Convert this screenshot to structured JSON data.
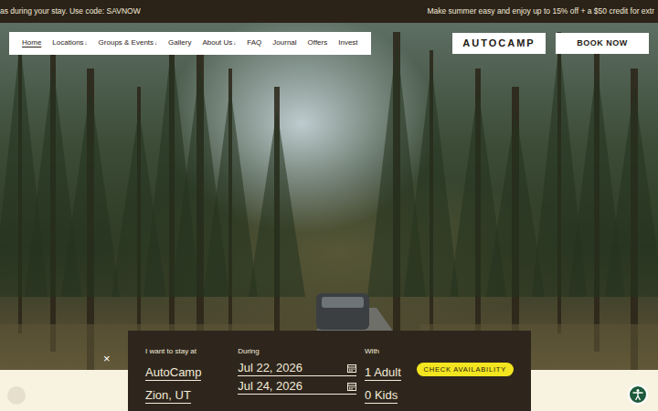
{
  "announcement": {
    "left": "as during your stay. Use code: SAVNOW",
    "right": "Make summer easy and enjoy up to 15% off + a $50 credit for extr"
  },
  "nav": {
    "items": [
      {
        "label": "Home",
        "selected": true
      },
      {
        "label": "Locations",
        "selected": false,
        "caret": "↓"
      },
      {
        "label": "Groups & Events",
        "selected": false,
        "caret": "↓"
      },
      {
        "label": "Gallery",
        "selected": false
      },
      {
        "label": "About Us",
        "selected": false,
        "caret": "↓"
      },
      {
        "label": "FAQ",
        "selected": false
      },
      {
        "label": "Journal",
        "selected": false
      },
      {
        "label": "Offers",
        "selected": false
      },
      {
        "label": "Invest",
        "selected": false
      }
    ]
  },
  "logo": "AUTOCAMP",
  "book_button": "BOOK NOW",
  "close_button": "×",
  "booking": {
    "location_label": "I want to stay at",
    "location": [
      "AutoCamp",
      "Zion, UT"
    ],
    "dates_label": "During",
    "dates": [
      "Jul 22, 2026",
      "Jul 24, 2026"
    ],
    "guests_label": "With",
    "guests": [
      "1 Adult",
      "0 Kids"
    ],
    "button": "CHECK AVAILABILITY"
  }
}
